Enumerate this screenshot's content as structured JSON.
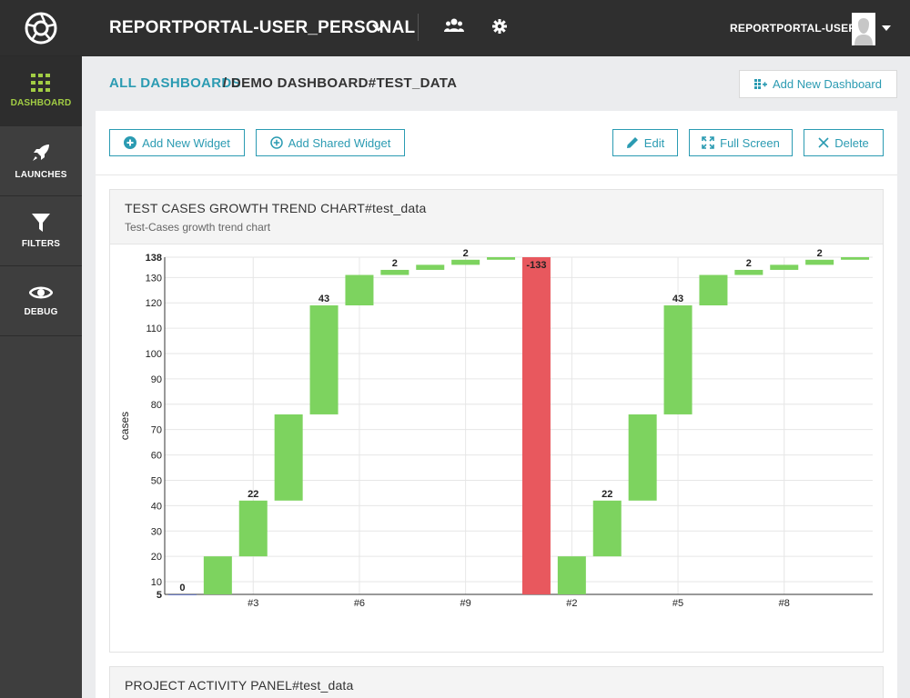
{
  "sidebar": {
    "items": [
      {
        "label": "DASHBOARD",
        "icon": "dashboard-grid-icon",
        "active": true
      },
      {
        "label": "LAUNCHES",
        "icon": "rocket-icon",
        "active": false
      },
      {
        "label": "FILTERS",
        "icon": "filter-funnel-icon",
        "active": false
      },
      {
        "label": "DEBUG",
        "icon": "eye-icon",
        "active": false
      }
    ]
  },
  "header": {
    "project_name": "REPORTPORTAL-USER_PERSONAL",
    "user_name": "REPORTPORTAL-USER"
  },
  "breadcrumb": {
    "all_label": "ALL DASHBOARDS",
    "current_label": "/ DEMO DASHBOARD#TEST_DATA"
  },
  "actions": {
    "add_new_dashboard": "Add New Dashboard",
    "add_new_widget": "Add New Widget",
    "add_shared_widget": "Add Shared Widget",
    "edit": "Edit",
    "full_screen": "Full Screen",
    "delete": "Delete"
  },
  "widget": {
    "title": "TEST CASES GROWTH TREND CHART#test_data",
    "description": "Test-Cases growth trend chart"
  },
  "widget2": {
    "title": "PROJECT ACTIVITY PANEL#test_data"
  },
  "colors": {
    "accent": "#2b9bb2",
    "brand_green": "#a2cd44",
    "bar_growth": "#7dd35f",
    "bar_decline": "#e8585e"
  },
  "chart_data": {
    "type": "bar",
    "subtype": "waterfall",
    "ylabel": "cases",
    "ylim": [
      5,
      138
    ],
    "yticks": [
      5,
      10,
      20,
      30,
      40,
      50,
      60,
      70,
      80,
      90,
      100,
      110,
      120,
      130,
      138
    ],
    "xtick_labels": [
      {
        "index": 2,
        "label": "#3"
      },
      {
        "index": 5,
        "label": "#6"
      },
      {
        "index": 8,
        "label": "#9"
      },
      {
        "index": 11,
        "label": "#2"
      },
      {
        "index": 14,
        "label": "#5"
      },
      {
        "index": 17,
        "label": "#8"
      }
    ],
    "grid": true,
    "bars": [
      {
        "start": 5,
        "delta": 0,
        "label": "0"
      },
      {
        "start": 5,
        "delta": 15,
        "label": ""
      },
      {
        "start": 20,
        "delta": 22,
        "label": "22"
      },
      {
        "start": 42,
        "delta": 34,
        "label": ""
      },
      {
        "start": 76,
        "delta": 43,
        "label": "43"
      },
      {
        "start": 119,
        "delta": 12,
        "label": ""
      },
      {
        "start": 131,
        "delta": 2,
        "label": "2"
      },
      {
        "start": 133,
        "delta": 2,
        "label": ""
      },
      {
        "start": 135,
        "delta": 2,
        "label": "2"
      },
      {
        "start": 137,
        "delta": 1,
        "label": ""
      },
      {
        "start": 138,
        "delta": -133,
        "label": "-133"
      },
      {
        "start": 5,
        "delta": 15,
        "label": ""
      },
      {
        "start": 20,
        "delta": 22,
        "label": "22"
      },
      {
        "start": 42,
        "delta": 34,
        "label": ""
      },
      {
        "start": 76,
        "delta": 43,
        "label": "43"
      },
      {
        "start": 119,
        "delta": 12,
        "label": ""
      },
      {
        "start": 131,
        "delta": 2,
        "label": "2"
      },
      {
        "start": 133,
        "delta": 2,
        "label": ""
      },
      {
        "start": 135,
        "delta": 2,
        "label": "2"
      },
      {
        "start": 137,
        "delta": 1,
        "label": ""
      }
    ]
  }
}
